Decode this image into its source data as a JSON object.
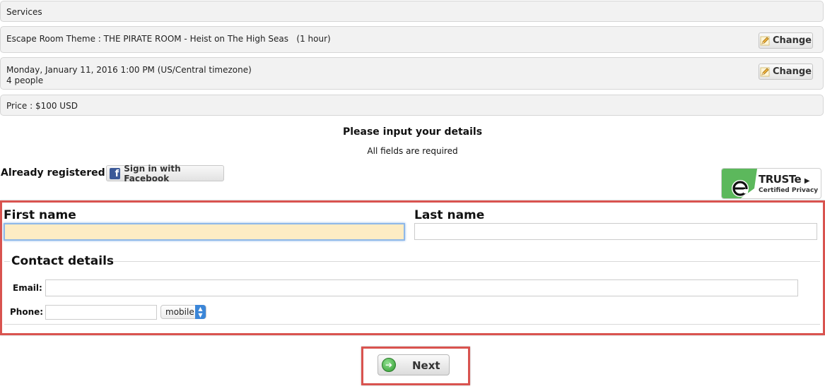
{
  "summary": {
    "services_label": "Services",
    "theme_text": "Escape Room Theme : THE PIRATE ROOM - Heist on The High Seas   (1 hour)",
    "datetime_text": "Monday, January 11, 2016 1:00 PM (US/Central timezone)",
    "people_text": "4 people",
    "price_text": "Price : $100 USD",
    "change_label": "Change"
  },
  "header": {
    "title": "Please input your details",
    "subtitle": "All fields are required"
  },
  "login": {
    "already_registered": "Already registered ?",
    "facebook_button": "Sign in with Facebook",
    "facebook_glyph": "f"
  },
  "truste": {
    "brand": "TRUSTe",
    "arrow": "▶",
    "subtitle": "Certified Privacy"
  },
  "form": {
    "first_name_label": "First name",
    "first_name_value": "",
    "last_name_label": "Last name",
    "last_name_value": "",
    "contact_legend": "Contact details",
    "email_label": "Email:",
    "email_value": "",
    "phone_label": "Phone:",
    "phone_value": "",
    "phone_type_selected": "mobile"
  },
  "actions": {
    "next_label": "Next"
  },
  "colors": {
    "highlight_border": "#d9534f",
    "focused_input_bg": "#fdecc4",
    "facebook_blue": "#3b5998",
    "truste_green": "#5cb85c"
  },
  "icons": {
    "change": "pencil-icon",
    "facebook": "facebook-icon",
    "truste": "truste-logo",
    "next": "arrow-right-circle-icon",
    "select": "select-arrows-icon"
  }
}
